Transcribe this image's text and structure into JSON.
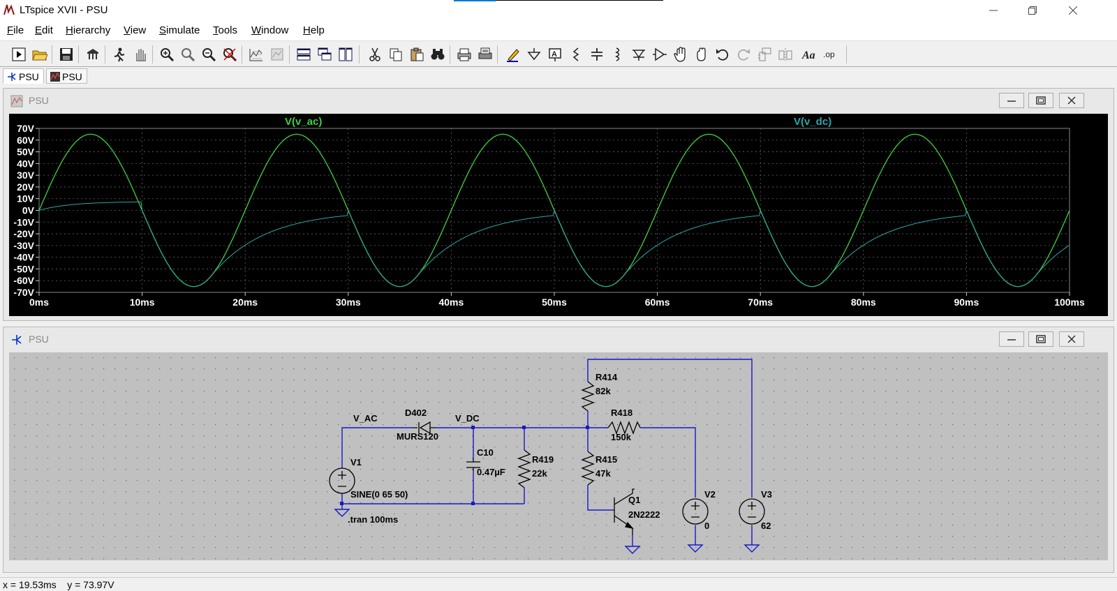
{
  "window": {
    "title": "LTspice XVII - PSU"
  },
  "menu": [
    "File",
    "Edit",
    "Hierarchy",
    "View",
    "Simulate",
    "Tools",
    "Window",
    "Help"
  ],
  "toolbar_icons": [
    "new-schematic-icon",
    "open-icon",
    "save-icon",
    "control-panel-icon",
    "run-icon",
    "halt-icon",
    "zoom-in-icon",
    "zoom-box-icon",
    "zoom-out-icon",
    "zoom-fit-icon",
    "autorange-icon",
    "plot-settings-icon",
    "tile-horizontal-icon",
    "cascade-icon",
    "tile-vertical-icon",
    "cut-icon",
    "copy-icon",
    "paste-icon",
    "find-icon",
    "print-preview-icon",
    "print-icon",
    "wire-icon",
    "ground-icon",
    "label-net-icon",
    "resistor-icon",
    "capacitor-icon",
    "inductor-icon",
    "diode-icon",
    "component-icon",
    "move-icon",
    "drag-icon",
    "undo-icon",
    "redo-icon",
    "rotate-icon",
    "mirror-icon",
    "text-icon",
    "spice-directive-icon"
  ],
  "tabs": [
    {
      "label": "PSU",
      "icon": "schematic-icon"
    },
    {
      "label": "PSU",
      "icon": "waveform-icon"
    }
  ],
  "waveform_window": {
    "title": "PSU"
  },
  "schematic_window": {
    "title": "PSU"
  },
  "chart_data": {
    "type": "line",
    "xlabel": "",
    "ylabel": "",
    "xlim": [
      0,
      100
    ],
    "ylim": [
      -70,
      70
    ],
    "x_ticks": [
      "0ms",
      "10ms",
      "20ms",
      "30ms",
      "40ms",
      "50ms",
      "60ms",
      "70ms",
      "80ms",
      "90ms",
      "100ms"
    ],
    "y_ticks": [
      "70V",
      "60V",
      "50V",
      "40V",
      "30V",
      "20V",
      "10V",
      "0V",
      "-10V",
      "-20V",
      "-30V",
      "-40V",
      "-50V",
      "-60V",
      "-70V"
    ],
    "grid": true,
    "background": "#000000",
    "series": [
      {
        "name": "V(v_ac)",
        "color": "#3fd23f",
        "x": [
          0,
          2.5,
          5,
          7.5,
          10,
          12.5,
          15,
          17.5,
          20,
          22.5,
          25,
          27.5,
          30,
          32.5,
          35,
          37.5,
          40,
          42.5,
          45,
          47.5,
          50,
          52.5,
          55,
          57.5,
          60,
          62.5,
          65,
          67.5,
          70,
          72.5,
          75,
          77.5,
          80,
          82.5,
          85,
          87.5,
          90,
          92.5,
          95,
          97.5,
          100
        ],
        "y": [
          0,
          46,
          65,
          46,
          0,
          -46,
          -65,
          -46,
          0,
          46,
          65,
          46,
          0,
          -46,
          -65,
          -46,
          0,
          46,
          65,
          46,
          0,
          -46,
          -65,
          -46,
          0,
          46,
          65,
          46,
          0,
          -46,
          -65,
          -46,
          0,
          46,
          65,
          46,
          0,
          -46,
          -65,
          -46,
          0
        ]
      },
      {
        "name": "V(v_dc)",
        "color": "#2aa8a8",
        "x": [
          0,
          2.5,
          5,
          7.5,
          10,
          12.5,
          15,
          17.5,
          20,
          22.5,
          25,
          27.5,
          30,
          32.5,
          35,
          37.5,
          40,
          42.5,
          45,
          47.5,
          50,
          52.5,
          55,
          57.5,
          60,
          62.5,
          65,
          67.5,
          70,
          72.5,
          75,
          77.5,
          80,
          82.5,
          85,
          87.5,
          90,
          92.5,
          95,
          97.5,
          100
        ],
        "y": [
          0,
          4,
          6,
          7,
          7.5,
          -46,
          -65,
          -46,
          -30,
          -20,
          -12,
          -6,
          0,
          -46,
          -65,
          -46,
          -30,
          -20,
          -12,
          -6,
          0,
          -46,
          -65,
          -46,
          -30,
          -20,
          -12,
          -6,
          0,
          -46,
          -65,
          -46,
          -30,
          -20,
          -12,
          -6,
          0,
          -46,
          -65,
          -46,
          -30
        ]
      }
    ]
  },
  "schematic": {
    "labels": {
      "v_ac_net": "V_AC",
      "v_dc_net": "V_DC",
      "d402_name": "D402",
      "d402_value": "MURS120",
      "c10_name": "C10",
      "c10_value": "0.47µF",
      "r419_name": "R419",
      "r419_value": "22k",
      "r414_name": "R414",
      "r414_value": "82k",
      "r418_name": "R418",
      "r418_value": "150k",
      "r415_name": "R415",
      "r415_value": "47k",
      "q1_name": "Q1",
      "q1_value": "2N2222",
      "v1_name": "V1",
      "v1_value": "SINE(0 65 50)",
      "v2_name": "V2",
      "v2_value": "0",
      "v3_name": "V3",
      "v3_value": "62",
      "tran_directive": ".tran 100ms"
    }
  },
  "status": {
    "text": "x = 19.53ms    y = 73.97V"
  }
}
